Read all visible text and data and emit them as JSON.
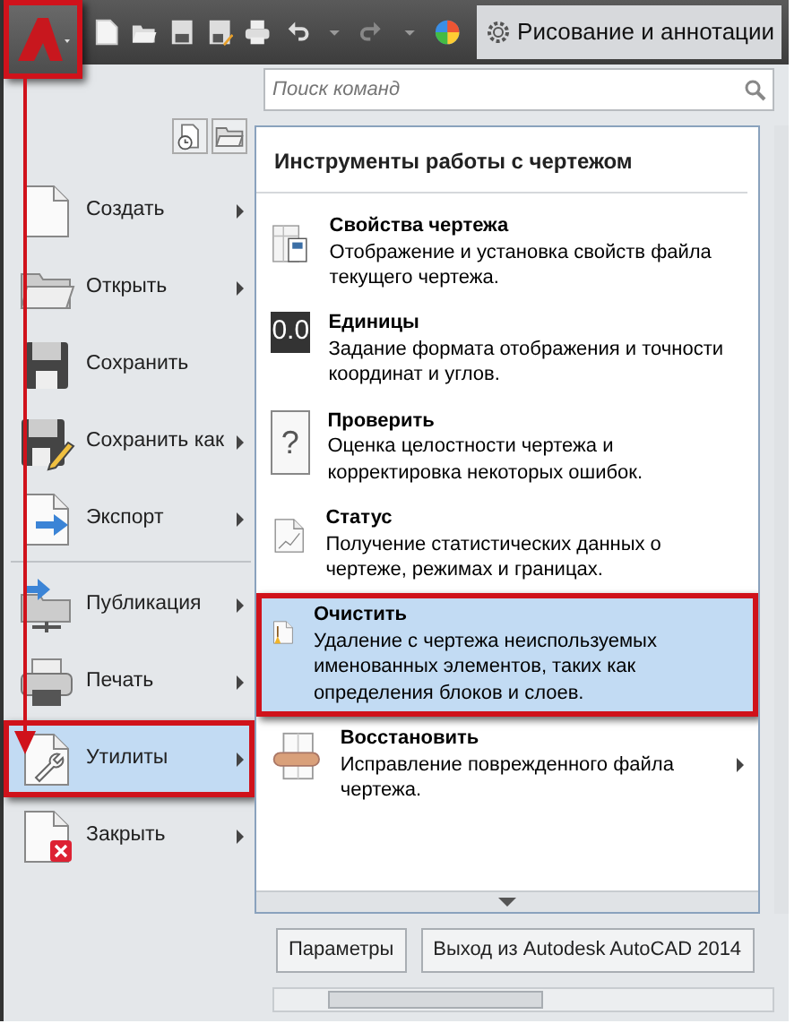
{
  "toolbar": {
    "app_button": {
      "annotated": true
    },
    "workspace": "Рисование и аннотации"
  },
  "search": {
    "placeholder": "Поиск команд"
  },
  "menu_items": [
    {
      "label": "Создать",
      "has_submenu": true,
      "selected": false,
      "annotated": false,
      "separator_before": false
    },
    {
      "label": "Открыть",
      "has_submenu": true,
      "selected": false,
      "annotated": false,
      "separator_before": false
    },
    {
      "label": "Сохранить",
      "has_submenu": false,
      "selected": false,
      "annotated": false,
      "separator_before": false
    },
    {
      "label": "Сохранить как",
      "has_submenu": true,
      "selected": false,
      "annotated": false,
      "separator_before": false
    },
    {
      "label": "Экспорт",
      "has_submenu": true,
      "selected": false,
      "annotated": false,
      "separator_before": false
    },
    {
      "label": "Публикация",
      "has_submenu": true,
      "selected": false,
      "annotated": false,
      "separator_before": true
    },
    {
      "label": "Печать",
      "has_submenu": true,
      "selected": false,
      "annotated": false,
      "separator_before": false
    },
    {
      "label": "Утилиты",
      "has_submenu": true,
      "selected": true,
      "annotated": true,
      "separator_before": false
    },
    {
      "label": "Закрыть",
      "has_submenu": true,
      "selected": false,
      "annotated": false,
      "separator_before": false
    }
  ],
  "panel": {
    "title": "Инструменты работы с чертежом",
    "items": [
      {
        "title": "Свойства чертежа",
        "description": "Отображение и установка свойств файла текущего чертежа.",
        "selected": false,
        "annotated": false,
        "has_submenu": false
      },
      {
        "title": "Единицы",
        "description": "Задание формата отображения и точности координат и углов.",
        "selected": false,
        "annotated": false,
        "has_submenu": false,
        "icon_text": "0.0"
      },
      {
        "title": "Проверить",
        "description": "Оценка целостности чертежа и корректировка некоторых ошибок.",
        "selected": false,
        "annotated": false,
        "has_submenu": false,
        "icon_text": "?"
      },
      {
        "title": "Статус",
        "description": "Получение статистических данных о чертеже, режимах и границах.",
        "selected": false,
        "annotated": false,
        "has_submenu": false
      },
      {
        "title": "Очистить",
        "description": "Удаление с чертежа неиспользуемых именованных элементов, таких как определения блоков и слоев.",
        "selected": true,
        "annotated": true,
        "has_submenu": false
      },
      {
        "title": "Восстановить",
        "description": "Исправление поврежденного файла чертежа.",
        "selected": false,
        "annotated": false,
        "has_submenu": true
      }
    ]
  },
  "buttons": [
    {
      "label": "Параметры"
    },
    {
      "label": "Выход из Autodesk AutoCAD 2014"
    }
  ]
}
